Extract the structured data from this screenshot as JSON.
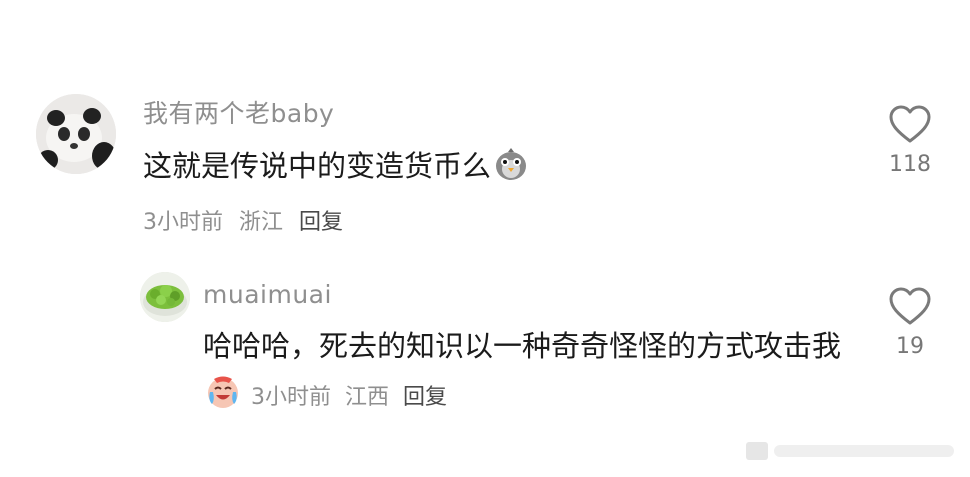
{
  "comments": [
    {
      "username": "我有两个老baby",
      "text": "这就是传说中的变造货币么",
      "time": "3小时前",
      "location": "浙江",
      "reply_label": "回复",
      "like_count": "118",
      "emoji": "penguin-face-emoji"
    },
    {
      "username": "muaimuai",
      "text": "哈哈哈，死去的知识以一种奇奇怪怪的方式攻击我",
      "time": "3小时前",
      "location": "江西",
      "reply_label": "回复",
      "like_count": "19",
      "emoji": "crying-laughing-emoji"
    }
  ],
  "icons": {
    "like": "heart-outline-icon"
  },
  "colors": {
    "text_primary": "#1b1b1b",
    "text_secondary": "#8f8f8f",
    "icon_gray": "#7a7a7a"
  }
}
